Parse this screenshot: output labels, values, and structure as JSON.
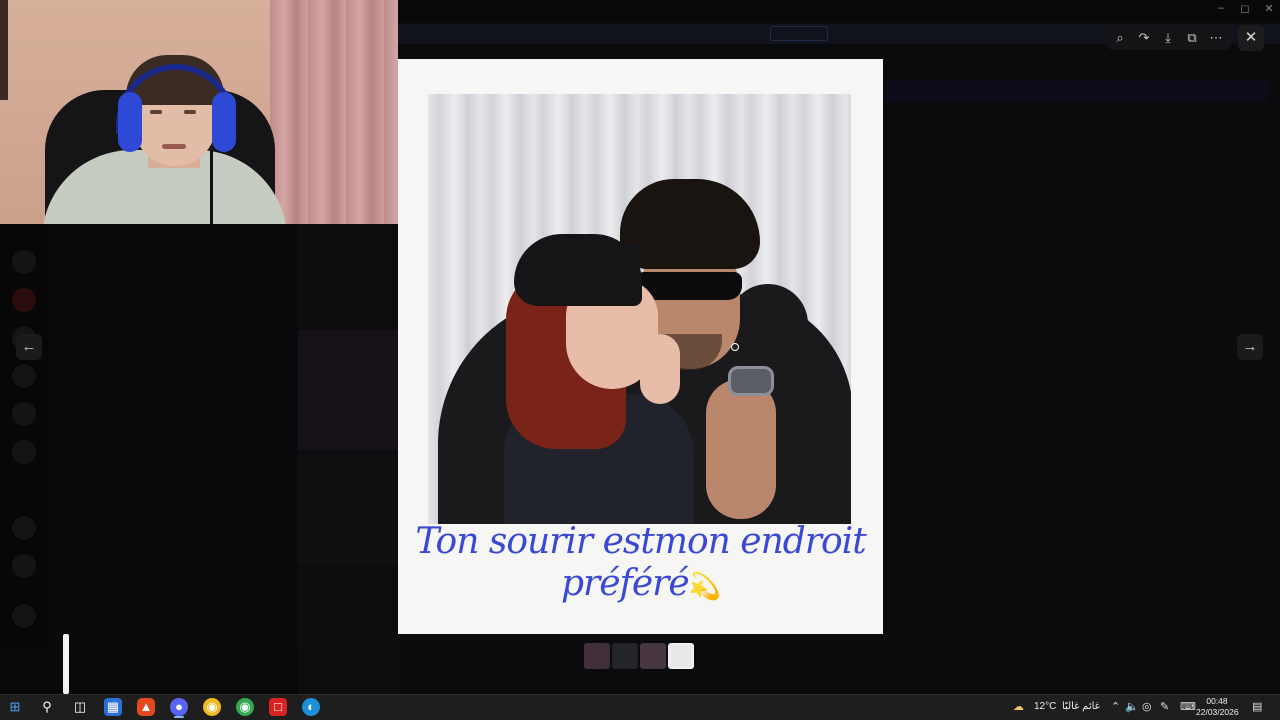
{
  "colors": {
    "caption": "#3a48d4",
    "taskbar": "#1e1e1e",
    "overlay": "#050505"
  },
  "viewer": {
    "toolbar": {
      "zoom_icon": "zoom-in-icon",
      "forward_icon": "forward-share-icon",
      "download_icon": "download-icon",
      "open_icon": "open-external-icon",
      "more_icon": "more-options-icon"
    },
    "close_icon": "close-icon",
    "prev_icon": "arrow-left-icon",
    "next_icon": "arrow-right-icon",
    "caption_line1": "Ton sourir estmon endroit",
    "caption_line2": "préféré",
    "caption_emoji": "💫",
    "thumbnails": [
      {
        "name": "thumbnail-1",
        "color": "#6e4f5c",
        "active": false
      },
      {
        "name": "thumbnail-2",
        "color": "#3d3a40",
        "active": false
      },
      {
        "name": "thumbnail-3",
        "color": "#7a5a6a",
        "active": false
      },
      {
        "name": "thumbnail-4",
        "color": "#e9e9e9",
        "active": true
      }
    ]
  },
  "taskbar": {
    "weather_temp": "12°C",
    "weather_text": "غائم غالبًا",
    "clock_time": "00:48",
    "clock_date": "22/03/2026",
    "apps": [
      "windows-start-icon",
      "search-icon",
      "task-view-icon",
      "microsoft-store-icon",
      "brave-browser-icon",
      "discord-icon",
      "chrome-canary-icon",
      "chrome-icon",
      "acrobat-icon",
      "edge-icon"
    ]
  }
}
